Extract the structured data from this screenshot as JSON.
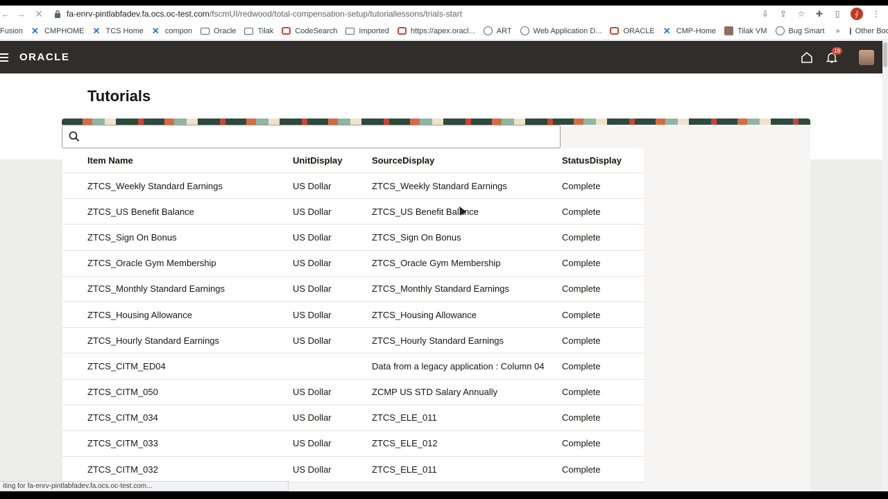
{
  "browser": {
    "url_host": "fa-enrv-pintlabfadev.fa.ocs.oc-test.com",
    "url_path": "/fscmUI/redwood/total-compensation-setup/tutoriallessons/trials-start",
    "bookmarks": [
      {
        "label": "Fusion",
        "icon": "folder-icon"
      },
      {
        "label": "CMPHOME",
        "icon": "confluence-icon"
      },
      {
        "label": "TCS Home",
        "icon": "confluence-icon"
      },
      {
        "label": "compon",
        "icon": "confluence-icon"
      },
      {
        "label": "Oracle",
        "icon": "folder-icon"
      },
      {
        "label": "Tilak",
        "icon": "folder-icon"
      },
      {
        "label": "CodeSearch",
        "icon": "oracle-icon"
      },
      {
        "label": "Imported",
        "icon": "folder-icon"
      },
      {
        "label": "https://apex.oracl...",
        "icon": "oracle-icon"
      },
      {
        "label": "ART",
        "icon": "globe-icon"
      },
      {
        "label": "Web Application D...",
        "icon": "globe-icon"
      },
      {
        "label": "ORACLE",
        "icon": "oracle-icon"
      },
      {
        "label": "CMP-Home",
        "icon": "confluence-icon"
      },
      {
        "label": "Tilak VM",
        "icon": "vm-icon"
      },
      {
        "label": "Bug Smart",
        "icon": "globe-icon"
      }
    ],
    "more_bookmarks": "»",
    "other_bookmarks": "Other Bookmarks",
    "status_text": "iting for fa-enrv-pintlabfadev.fa.ocs.oc-test.com..."
  },
  "header": {
    "logo": "ORACLE",
    "notification_count": "19"
  },
  "page": {
    "title": "Tutorials",
    "search_placeholder": ""
  },
  "table": {
    "columns": [
      "Item Name",
      "UnitDisplay",
      "SourceDisplay",
      "StatusDisplay"
    ],
    "rows": [
      [
        "ZTCS_Weekly Standard Earnings",
        "US Dollar",
        "ZTCS_Weekly Standard Earnings",
        "Complete"
      ],
      [
        "ZTCS_US Benefit Balance",
        "US Dollar",
        "ZTCS_US Benefit Balance",
        "Complete"
      ],
      [
        "ZTCS_Sign On Bonus",
        "US Dollar",
        "ZTCS_Sign On Bonus",
        "Complete"
      ],
      [
        "ZTCS_Oracle Gym Membership",
        "US Dollar",
        "ZTCS_Oracle Gym Membership",
        "Complete"
      ],
      [
        "ZTCS_Monthly Standard Earnings",
        "US Dollar",
        "ZTCS_Monthly Standard Earnings",
        "Complete"
      ],
      [
        "ZTCS_Housing Allowance",
        "US Dollar",
        "ZTCS_Housing Allowance",
        "Complete"
      ],
      [
        "ZTCS_Hourly Standard Earnings",
        "US Dollar",
        "ZTCS_Hourly Standard Earnings",
        "Complete"
      ],
      [
        "ZTCS_CITM_ED04",
        "",
        "Data from a legacy application : Column 04",
        "Complete"
      ],
      [
        "ZTCS_CITM_050",
        "US Dollar",
        "ZCMP US STD Salary Annually",
        "Complete"
      ],
      [
        "ZTCS_CITM_034",
        "US Dollar",
        "ZTCS_ELE_011",
        "Complete"
      ],
      [
        "ZTCS_CITM_033",
        "US Dollar",
        "ZTCS_ELE_012",
        "Complete"
      ],
      [
        "ZTCS_CITM_032",
        "US Dollar",
        "ZTCS_ELE_011",
        "Complete"
      ]
    ]
  }
}
